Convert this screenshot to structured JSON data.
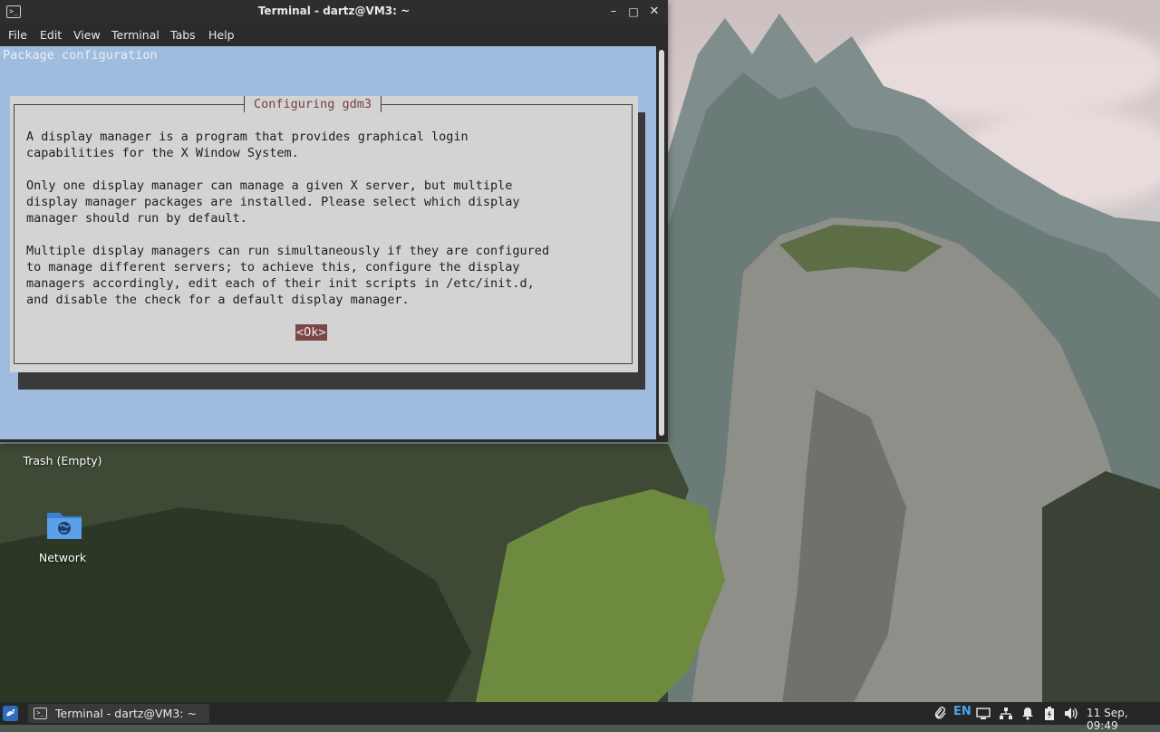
{
  "window": {
    "title": "Terminal - dartz@VM3: ~",
    "app_icon_glyph": ">_",
    "controls": {
      "minimize": "–",
      "maximize": "□",
      "close": "✕"
    }
  },
  "menubar": {
    "items": [
      "File",
      "Edit",
      "View",
      "Terminal",
      "Tabs",
      "Help"
    ]
  },
  "terminal": {
    "header": "Package configuration",
    "dialog": {
      "title": "Configuring gdm3",
      "paragraphs": [
        [
          "A display manager is a program that provides graphical login",
          "capabilities for the X Window System."
        ],
        [
          "Only one display manager can manage a given X server, but multiple",
          "display manager packages are installed. Please select which display",
          "manager should run by default."
        ],
        [
          "Multiple display managers can run simultaneously if they are configured",
          "to manage different servers; to achieve this, configure the display",
          "managers accordingly, edit each of their init scripts in /etc/init.d,",
          "and disable the check for a default display manager."
        ]
      ],
      "ok_label": "<Ok>"
    }
  },
  "desktop": {
    "icons": [
      {
        "label": "Trash (Empty)",
        "icon": "trash-icon"
      },
      {
        "label": "Network",
        "icon": "network-folder-icon"
      }
    ]
  },
  "taskbar": {
    "task_label": "Terminal - dartz@VM3: ~",
    "language": "EN",
    "clock": "11 Sep, 09:49",
    "tray_icons": [
      "paperclip-icon",
      "keyboard-layout-icon",
      "display-icon",
      "notification-bell-icon",
      "network-icon",
      "battery-icon",
      "volume-icon"
    ]
  },
  "colors": {
    "terminal_background": "#9fbcde",
    "dialog_background": "#d3d3d3",
    "dialog_title": "#7a4040",
    "ok_button": "#7b4646",
    "accent_blue": "#2f6cc0"
  }
}
